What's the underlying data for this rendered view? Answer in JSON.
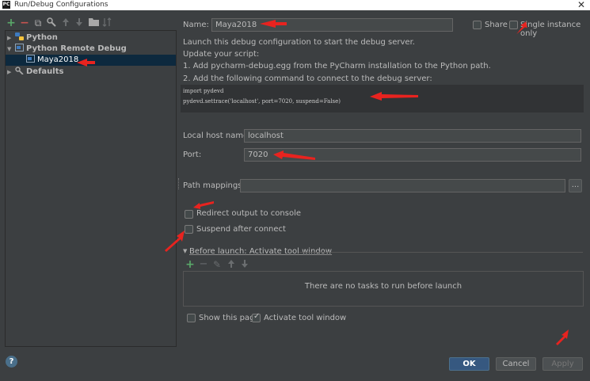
{
  "window": {
    "title": "Run/Debug Configurations",
    "close_glyph": "✕"
  },
  "toolbar": {
    "icons": [
      "add-icon",
      "remove-icon",
      "copy-icon",
      "wrench-icon",
      "move-up-icon",
      "move-down-icon",
      "folder-icon",
      "sort-icon"
    ],
    "add": "+",
    "remove": "−",
    "copy": "⧉",
    "settings": "🔧",
    "up": "🡑",
    "down": "🡓",
    "folder": "▬",
    "sort": "⇅"
  },
  "tree": {
    "items": [
      {
        "label": "Python",
        "expanded": false
      },
      {
        "label": "Python Remote Debug",
        "expanded": true
      },
      {
        "label": "Maya2018",
        "selected": true
      },
      {
        "label": "Defaults",
        "expanded": false
      }
    ]
  },
  "form": {
    "name_label": "Name:",
    "name_value": "Maya2018",
    "share_label": "Share",
    "single_instance_label": "Single instance only",
    "description": [
      "Launch this debug configuration to start the debug server.",
      "Update your script:",
      "1. Add pycharm-debug.egg from the PyCharm installation to the Python path.",
      "2. Add the following command to connect to the debug server:"
    ],
    "code_lines": [
      "import pydevd",
      "pydevd.settrace('localhost', port=7020, suspend=False)"
    ],
    "host_label": "Local host name:",
    "host_value": "localhost",
    "port_label": "Port:",
    "port_value": "7020",
    "path_mappings_label": "Path mappings:",
    "path_mappings_value": "",
    "browse_label": "...",
    "redirect_label": "Redirect output to console",
    "redirect_checked": false,
    "suspend_label": "Suspend after connect",
    "suspend_checked": false
  },
  "before_launch": {
    "header": "Before launch: Activate tool window",
    "empty_text": "There are no tasks to run before launch",
    "show_page_label": "Show this page",
    "show_page_checked": false,
    "activate_label": "Activate tool window",
    "activate_checked": true,
    "toolbar": {
      "add": "+",
      "remove": "−",
      "edit": "✎",
      "up": "🡑",
      "down": "🡓"
    }
  },
  "buttons": {
    "help": "?",
    "ok": "OK",
    "cancel": "Cancel",
    "apply": "Apply"
  },
  "colors": {
    "background": "#3c3f41",
    "selection": "#0d293e",
    "accent": "#365880",
    "annotation_red": "#e8231f"
  }
}
